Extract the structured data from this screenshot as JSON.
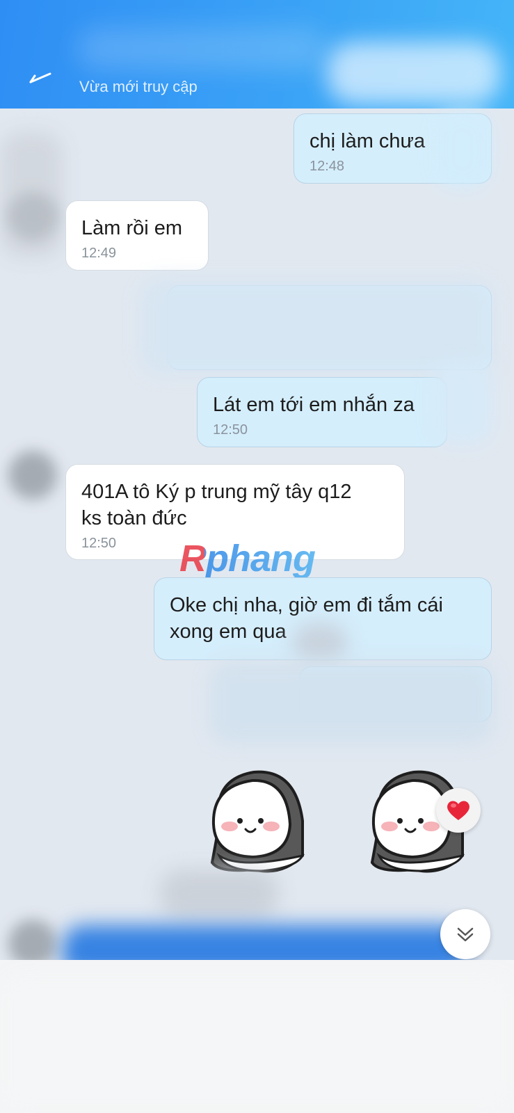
{
  "header": {
    "status": "Vừa mới truy cập"
  },
  "messages": [
    {
      "text": "chị làm chưa",
      "time": "12:48"
    },
    {
      "text": "Làm rồi em",
      "time": "12:49"
    },
    {
      "text": "Lát em tới em nhắn za",
      "time": "12:50"
    },
    {
      "text": "401A tô Ký p trung mỹ tây q12\nks toàn đức",
      "time": "12:50"
    },
    {
      "text": "Oke chị nha, giờ em đi tắm cái\nxong em qua",
      "time": ""
    }
  ],
  "watermark": "Rphang",
  "icons": {
    "back": "arrow-left-icon",
    "heart": "heart-icon",
    "scroll_down": "double-chevron-down-icon"
  },
  "colors": {
    "header_blue": "#2f8ef4",
    "incoming_bubble": "#ffffff",
    "outgoing_bubble": "#d5eefc",
    "chat_background": "#e2e8f0",
    "heart": "#e8263a"
  }
}
